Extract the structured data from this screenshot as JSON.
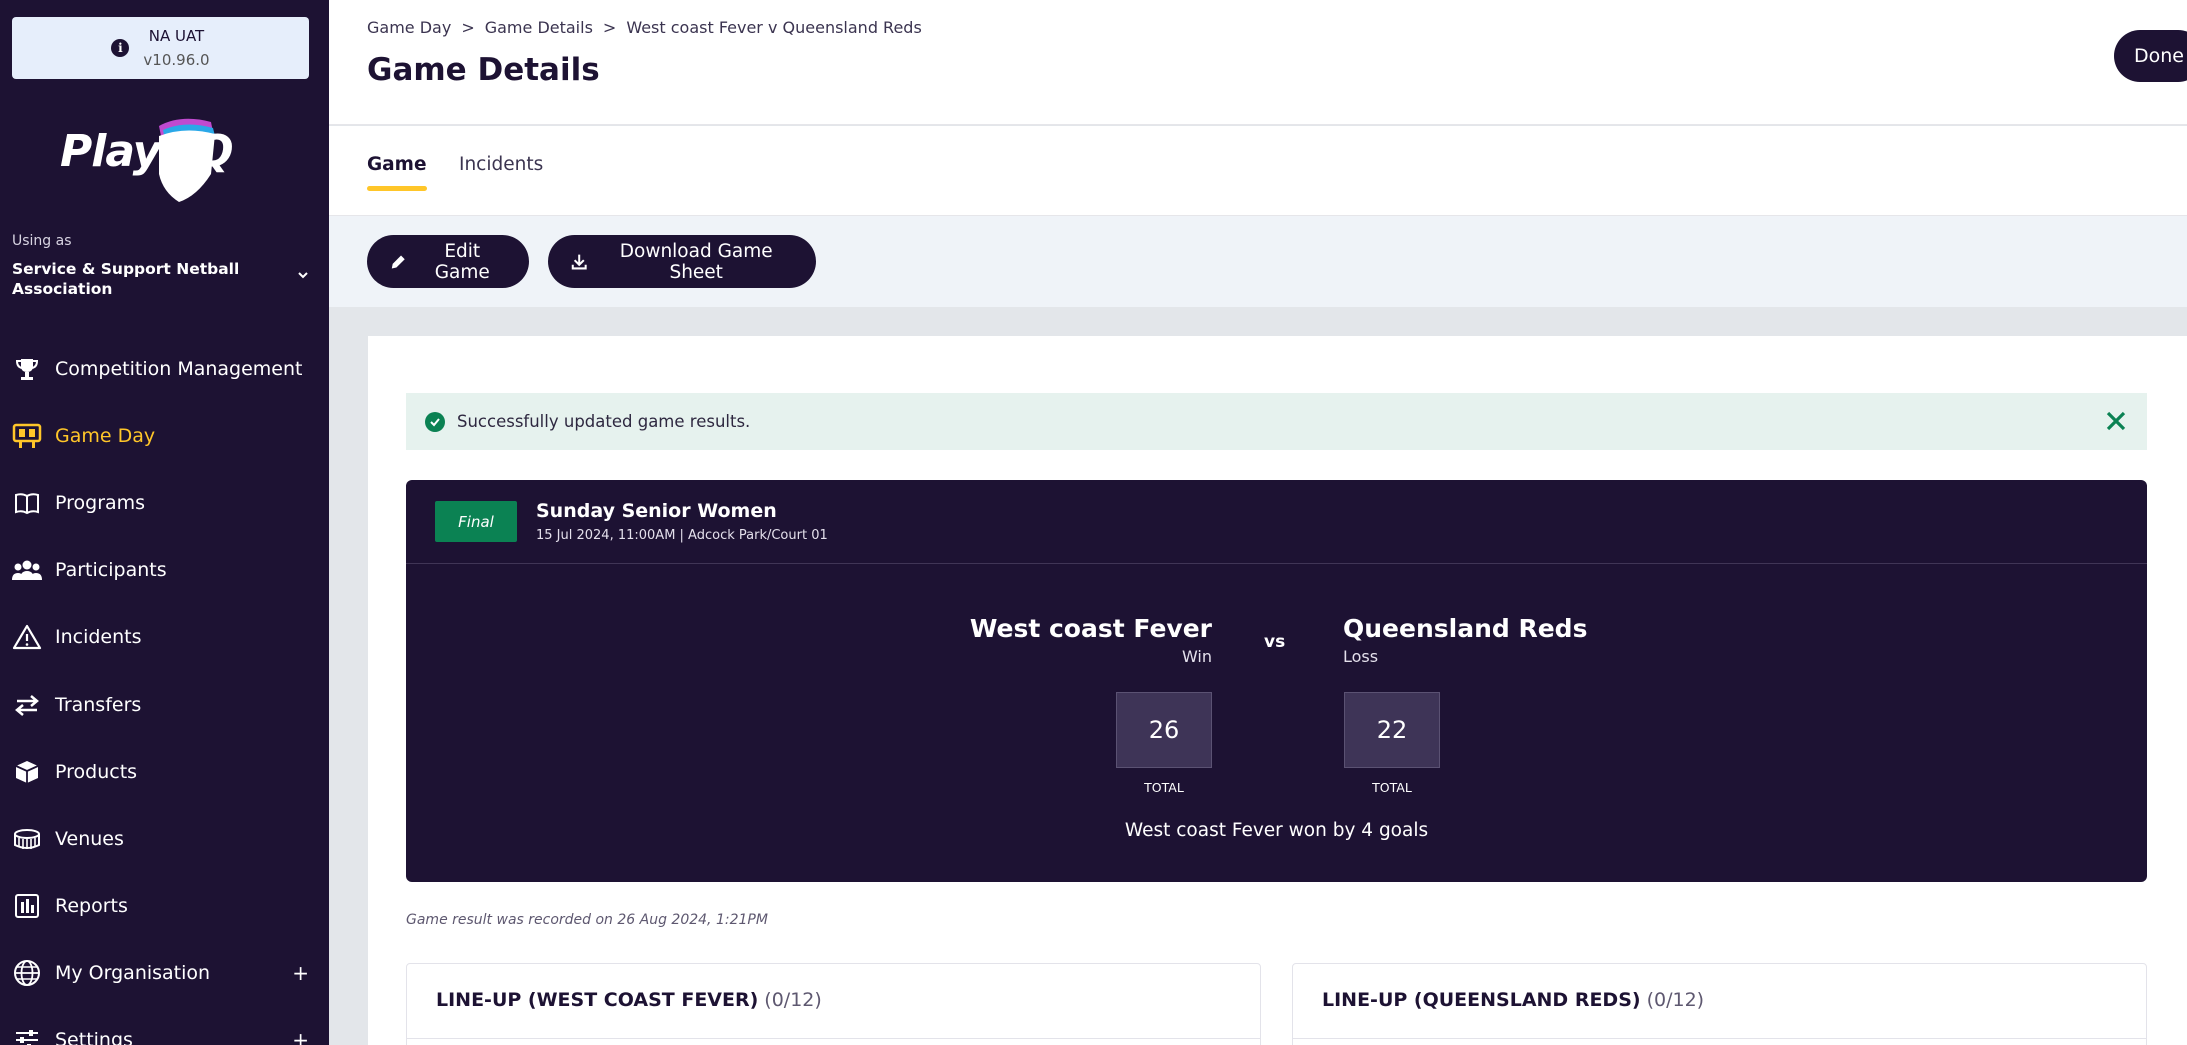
{
  "env": {
    "name": "NA UAT",
    "version": "v10.96.0",
    "icon": "info-icon"
  },
  "logo": {
    "text": "PlayHQ"
  },
  "sidebar": {
    "using_as_label": "Using as",
    "org_name": "Service & Support Netball Association",
    "items": [
      {
        "label": "Competition Management",
        "icon": "trophy-icon",
        "active": false,
        "expandable": false
      },
      {
        "label": "Game Day",
        "icon": "scoreboard-icon",
        "active": true,
        "expandable": false
      },
      {
        "label": "Programs",
        "icon": "book-icon",
        "active": false,
        "expandable": false
      },
      {
        "label": "Participants",
        "icon": "people-icon",
        "active": false,
        "expandable": false
      },
      {
        "label": "Incidents",
        "icon": "warning-icon",
        "active": false,
        "expandable": false
      },
      {
        "label": "Transfers",
        "icon": "transfer-arrows-icon",
        "active": false,
        "expandable": false
      },
      {
        "label": "Products",
        "icon": "box-icon",
        "active": false,
        "expandable": false
      },
      {
        "label": "Venues",
        "icon": "stadium-icon",
        "active": false,
        "expandable": false
      },
      {
        "label": "Reports",
        "icon": "report-chart-icon",
        "active": false,
        "expandable": false
      },
      {
        "label": "My Organisation",
        "icon": "globe-icon",
        "active": false,
        "expandable": true
      },
      {
        "label": "Settings",
        "icon": "sliders-icon",
        "active": false,
        "expandable": true
      }
    ],
    "expand_symbol": "+"
  },
  "header": {
    "breadcrumb": [
      "Game Day",
      "Game Details",
      "West coast Fever v Queensland Reds"
    ],
    "breadcrumb_separator": ">",
    "title": "Game Details",
    "done_label": "Done"
  },
  "tabs": [
    {
      "label": "Game",
      "active": true
    },
    {
      "label": "Incidents",
      "active": false
    }
  ],
  "actions": {
    "edit_label": "Edit Game",
    "download_label": "Download Game Sheet"
  },
  "banner": {
    "message": "Successfully updated game results."
  },
  "game": {
    "status": "Final",
    "competition": "Sunday Senior Women",
    "meta": "15 Jul 2024, 11:00AM | Adcock Park/Court 01",
    "vs_label": "vs",
    "home": {
      "name": "West coast Fever",
      "result": "Win",
      "score": "26",
      "score_label": "TOTAL"
    },
    "away": {
      "name": "Queensland Reds",
      "result": "Loss",
      "score": "22",
      "score_label": "TOTAL"
    },
    "summary": "West coast Fever won by 4 goals",
    "recorded_note": "Game result was recorded on 26 Aug 2024, 1:21PM"
  },
  "lineups": [
    {
      "title": "LINE-UP (WEST COAST FEVER)",
      "count": "(0/12)"
    },
    {
      "title": "LINE-UP (QUEENSLAND REDS)",
      "count": "(0/12)"
    }
  ],
  "colors": {
    "navy": "#1d1233",
    "accent_yellow": "#ffc629",
    "success_green": "#0b8253",
    "banner_bg": "#e6f2ee"
  }
}
